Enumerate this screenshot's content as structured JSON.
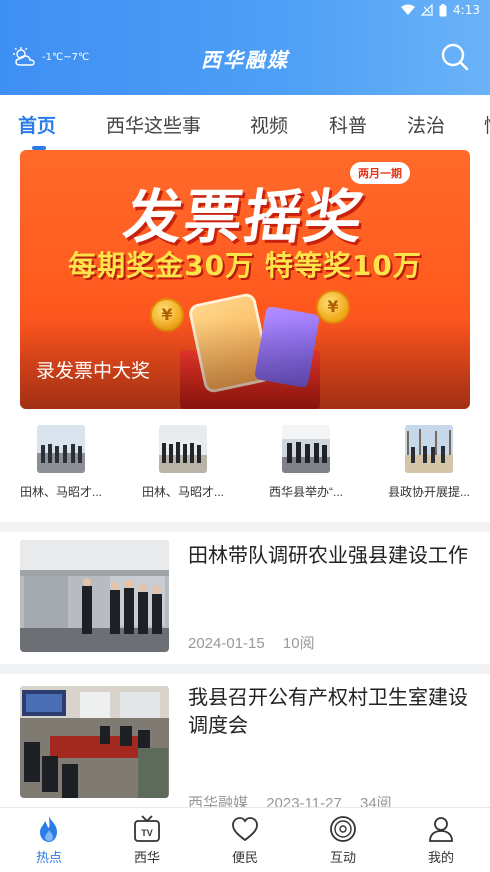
{
  "status_bar": {
    "time": "4:13"
  },
  "header": {
    "weather_icon": "partly-cloudy-icon",
    "temperature": "-1℃~7℃",
    "brand": "西华融媒",
    "search_icon": "search-icon"
  },
  "tabs": [
    {
      "label": "首页",
      "active": true
    },
    {
      "label": "西华这些事"
    },
    {
      "label": "视频"
    },
    {
      "label": "科普"
    },
    {
      "label": "法治"
    },
    {
      "label": "情"
    }
  ],
  "banner": {
    "headline": "发票摇奖",
    "badge": "两月一期",
    "subline": "每期奖金30万 特等奖10万",
    "caption": "录发票中大奖",
    "accent": "#ff5a1f"
  },
  "thumbs": [
    {
      "label": "田林、马昭才..."
    },
    {
      "label": "田林、马昭才..."
    },
    {
      "label": "西华县举办“..."
    },
    {
      "label": "县政协开展提..."
    }
  ],
  "news": [
    {
      "title": "田林带队调研农业强县建设工作",
      "date": "2024-01-15",
      "reads": "10阅"
    },
    {
      "title": "我县召开公有产权村卫生室建设调度会",
      "source": "西华融媒",
      "date": "2023-11-27",
      "reads": "34阅"
    }
  ],
  "bottom_nav": [
    {
      "label": "热点",
      "icon": "flame-icon",
      "active": true
    },
    {
      "label": "西华",
      "icon": "tv-icon"
    },
    {
      "label": "便民",
      "icon": "heart-icon"
    },
    {
      "label": "互动",
      "icon": "disc-icon"
    },
    {
      "label": "我的",
      "icon": "user-icon"
    }
  ],
  "colors": {
    "primary": "#2a7ce8",
    "header": "#4a98f5"
  }
}
